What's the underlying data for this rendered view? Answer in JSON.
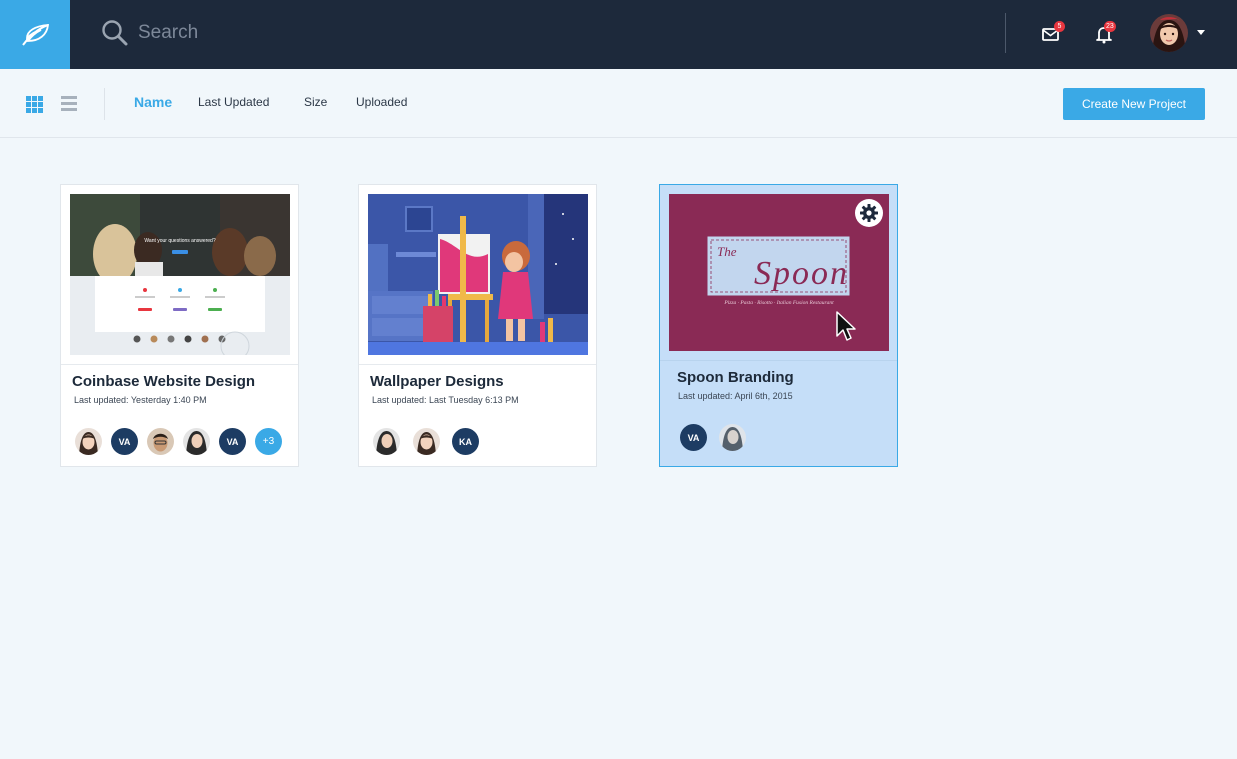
{
  "header": {
    "search_placeholder": "Search",
    "messages_badge": "5",
    "notifications_badge": "23"
  },
  "toolbar": {
    "sort_tabs": [
      "Name",
      "Last Updated",
      "Size",
      "Uploaded"
    ],
    "active_sort": "Name",
    "create_label": "Create New Project"
  },
  "projects": [
    {
      "title": "Coinbase Website Design",
      "meta": "Last updated: Yesterday 1:40 PM",
      "avatars": [
        "photo",
        "VA",
        "photo",
        "photo",
        "VA",
        "+3"
      ]
    },
    {
      "title": "Wallpaper Designs",
      "meta": "Last updated: Last Tuesday 6:13 PM",
      "avatars": [
        "photo",
        "photo",
        "KA"
      ]
    },
    {
      "title": "Spoon Branding",
      "meta": "Last updated: April 6th, 2015",
      "avatars": [
        "VA",
        "photo"
      ],
      "selected": true
    }
  ],
  "thumbnails": {
    "coinbase_headline": "Want your questions answered?",
    "spoon_logo_the": "The",
    "spoon_logo_name": "Spoon",
    "spoon_tagline": "Pizza · Pasta · Risotto · Italian Fusion Restaurant"
  },
  "colors": {
    "brand_blue": "#3aa9e6",
    "topbar": "#1d293b",
    "selected_card": "#c5def8",
    "badge_red": "#e8363f",
    "spoon_maroon": "#8a2a55"
  },
  "icons": [
    "feather-logo-icon",
    "search-icon",
    "mail-icon",
    "bell-icon",
    "grid-view-icon",
    "list-view-icon",
    "gear-icon",
    "cursor-pointer-icon"
  ]
}
